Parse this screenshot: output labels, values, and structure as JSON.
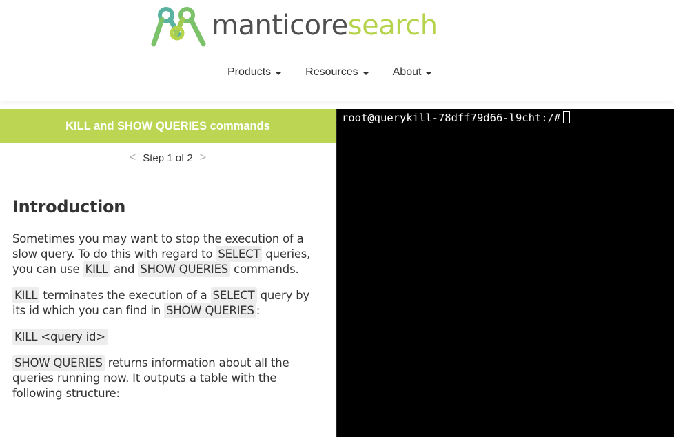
{
  "brand": {
    "name_part1": "manticore",
    "name_part2": "search",
    "color_dark": "#4f4f4f",
    "color_accent": "#b5d34b",
    "logo_icon": "manticore-logo-icon"
  },
  "nav": {
    "items": [
      {
        "label": "Products"
      },
      {
        "label": "Resources"
      },
      {
        "label": "About"
      }
    ]
  },
  "lesson": {
    "title": "KILL and SHOW QUERIES commands",
    "step_text": "Step 1 of 2",
    "prev_symbol": "<",
    "next_symbol": ">",
    "heading": "Introduction",
    "p1": {
      "t1": "Sometimes you may want to stop the execution of a slow query. To do this with regard to ",
      "c1": "SELECT",
      "t2": " queries, you can use ",
      "c2": "KILL",
      "t3": " and ",
      "c3": "SHOW QUERIES",
      "t4": " commands."
    },
    "p2": {
      "c1": "KILL",
      "t1": " terminates the execution of a ",
      "c2": "SELECT",
      "t2": " query by its id which you can find in ",
      "c3": "SHOW QUERIES",
      "t3": ":"
    },
    "p3": {
      "c1": "KILL <query id>"
    },
    "p4": {
      "c1": "SHOW QUERIES",
      "t1": " returns information about all the queries running now. It outputs a table with the following structure:"
    }
  },
  "terminal": {
    "prompt": "root@querykill-78dff79d66-l9cht:/#"
  }
}
